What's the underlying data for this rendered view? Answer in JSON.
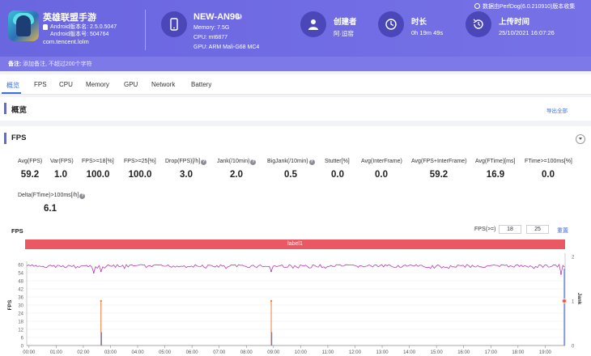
{
  "app": {
    "name": "英雄联盟手游",
    "version_name": "Android版本名: 2.5.0.5047",
    "version_code": "Android版本号: 504764",
    "package": "com.tencent.lolm"
  },
  "device": {
    "name": "NEW-AN90",
    "memory": "Memory: 7.5G",
    "cpu": "CPU: mt6877",
    "gpu": "GPU: ARM Mali-G68 MC4"
  },
  "creator": {
    "label": "创建者",
    "value": "阿·迢窑"
  },
  "duration": {
    "label": "时长",
    "value": "0h 19m 49s"
  },
  "upload": {
    "label": "上传时间",
    "value": "25/10/2021 16:07:26"
  },
  "source": "数据由PerfDog(6.0.210910)版本收集",
  "note": {
    "label": "备注:",
    "placeholder": "添加备注, 不超过200个字符"
  },
  "tabs": [
    {
      "label": "概览",
      "active": true
    },
    {
      "label": "FPS"
    },
    {
      "label": "CPU"
    },
    {
      "label": "Memory"
    },
    {
      "label": "GPU"
    },
    {
      "label": "Network"
    },
    {
      "label": "Battery"
    }
  ],
  "overview": {
    "title": "概览",
    "export_label": "导出全部"
  },
  "fps_section": {
    "title": "FPS",
    "metrics": [
      {
        "label": "Avg(FPS)",
        "value": "59.2",
        "help": false
      },
      {
        "label": "Var(FPS)",
        "value": "1.0",
        "help": false
      },
      {
        "label": "FPS>=18[%]",
        "value": "100.0",
        "help": false
      },
      {
        "label": "FPS>=25[%]",
        "value": "100.0",
        "help": false
      },
      {
        "label": "Drop(FPS)[/h]",
        "value": "3.0",
        "help": true
      },
      {
        "label": "Jank(/10min)",
        "value": "2.0",
        "help": true
      },
      {
        "label": "BigJank(/10min)",
        "value": "0.5",
        "help": true
      },
      {
        "label": "Stutter[%]",
        "value": "0.0",
        "help": false
      },
      {
        "label": "Avg(InterFrame)",
        "value": "0.0",
        "help": false
      },
      {
        "label": "Avg(FPS+InterFrame)",
        "value": "59.2",
        "help": false
      },
      {
        "label": "Avg(FTime)[ms]",
        "value": "16.9",
        "help": false
      },
      {
        "label": "FTime>=100ms[%]",
        "value": "0.0",
        "help": false
      },
      {
        "label": "Delta(FTime)>100ms[/h]",
        "value": "6.1",
        "help": true
      }
    ],
    "chart_title": "FPS",
    "threshold_label": "FPS(>=)",
    "threshold_1": "18",
    "threshold_2": "25",
    "reset_label": "重置",
    "label_bar": "label1"
  },
  "colors": {
    "header": "#6a66e0",
    "accent": "#3b6fe0",
    "fps_line": "#b43cb4",
    "jank": "#f07a3a",
    "bigjank": "#5a7fd8",
    "label_bar": "#e95863"
  },
  "chart_data": {
    "type": "line",
    "title": "FPS",
    "xlabel": "",
    "ylabel": "FPS",
    "y2label": "Jank",
    "x_ticks": [
      "00:00",
      "01:00",
      "02:00",
      "03:00",
      "04:00",
      "05:00",
      "06:00",
      "07:00",
      "08:00",
      "09:00",
      "10:00",
      "11:00",
      "12:00",
      "13:00",
      "14:00",
      "15:00",
      "16:00",
      "17:00",
      "18:00",
      "19:00"
    ],
    "y_ticks": [
      0,
      3,
      6,
      9,
      12,
      15,
      18,
      21,
      24,
      27,
      30,
      33,
      36,
      39,
      42,
      45,
      48,
      51,
      54,
      57,
      60
    ],
    "y2_ticks": [
      0,
      1,
      2
    ],
    "ylim": [
      0,
      60
    ],
    "y2lim": [
      0,
      2
    ],
    "x_range_seconds": [
      0,
      1189
    ],
    "series": [
      {
        "name": "FPS",
        "kind": "line",
        "approx_mean": 59.2,
        "approx_range": [
          56,
          60
        ]
      },
      {
        "name": "Jank",
        "kind": "spikes",
        "x_seconds": [
          164,
          540
        ],
        "values": [
          1,
          1
        ]
      },
      {
        "name": "BigJank",
        "kind": "spikes",
        "x_seconds": [
          164,
          540
        ],
        "values": [
          0.3,
          0.3
        ]
      }
    ],
    "fps_dips": [
      {
        "x_seconds": 148,
        "value": 54
      },
      {
        "x_seconds": 164,
        "value": 55
      },
      {
        "x_seconds": 540,
        "value": 55
      },
      {
        "x_seconds": 1180,
        "value": 53
      }
    ],
    "end_marker": {
      "x_seconds": 1189,
      "jank": 1
    },
    "grid": true,
    "legend": "none"
  }
}
